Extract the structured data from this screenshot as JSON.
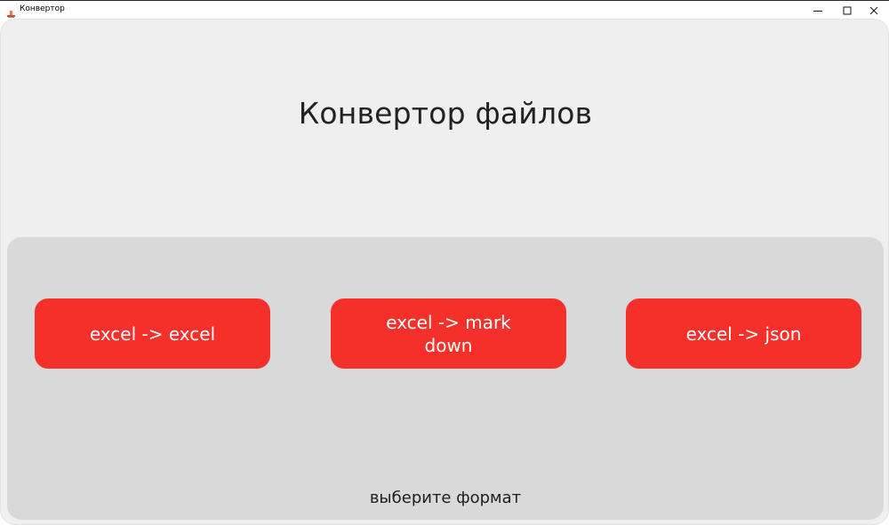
{
  "window": {
    "title": "Конвертор",
    "icon": "app-icon"
  },
  "main": {
    "title": "Конвертор файлов",
    "hint": "выберите формат",
    "buttons": [
      {
        "label": "excel -> excel"
      },
      {
        "label": "excel -> mark down"
      },
      {
        "label": "excel -> json"
      }
    ]
  },
  "colors": {
    "accent": "#f5302a",
    "background": "#efefef",
    "panel": "#d9d9d9"
  }
}
